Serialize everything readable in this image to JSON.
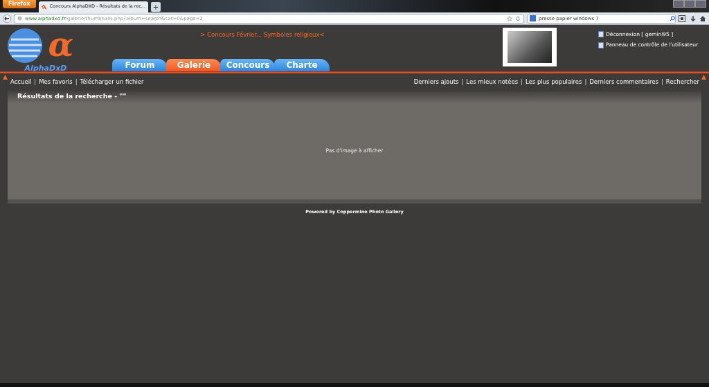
{
  "browser": {
    "app_button": "Firefox",
    "tabs": [
      {
        "title": "Concours AlphaDXD - Résultats de la rec...",
        "selected": true
      }
    ],
    "new_tab": "+",
    "url_host": "www.alphadxd.fr",
    "url_path": "/galerie/thumbnails.php?album=search&cat=0&page=2",
    "search": {
      "value": "presse papier windows 7"
    }
  },
  "header": {
    "logo": {
      "symbol": "α",
      "name": "AlphaDxD"
    },
    "announcement": "> Concours Février... Symboles religieux<",
    "tabs": [
      {
        "label": "Forum",
        "selected": false
      },
      {
        "label": "Galerie",
        "selected": true
      },
      {
        "label": "Concours",
        "selected": false
      },
      {
        "label": "Charte",
        "selected": false
      }
    ],
    "user_links": [
      "Déconnexion [ gemini95 ]",
      "Panneau de contrôle de l'utilisateur"
    ]
  },
  "nav": {
    "separator": "|",
    "left": [
      "Accueil",
      "Mes favoris",
      "Télécharger un fichier"
    ],
    "right": [
      "Derniers ajouts",
      "Les mieux notées",
      "Les plus populaires",
      "Derniers commentaires",
      "Rechercher"
    ]
  },
  "results": {
    "title": "Résultats de la recherche - \"\"",
    "empty_message": "Pas d'image à afficher"
  },
  "footer": {
    "prefix": "Powered by",
    "link": "Coppermine Photo Gallery"
  }
}
